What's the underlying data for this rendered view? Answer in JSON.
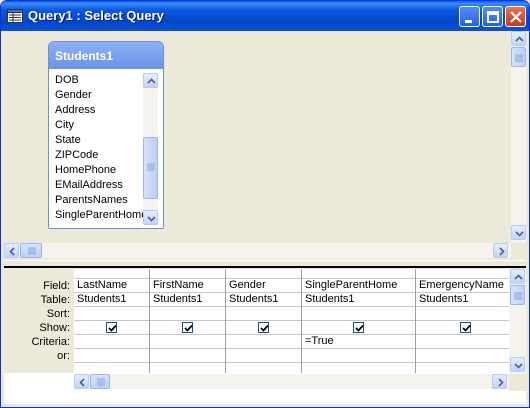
{
  "window": {
    "title": "Query1 : Select Query",
    "icon": "query-window-icon",
    "controls": [
      "minimize-icon",
      "maximize-icon",
      "close-icon"
    ],
    "titlebar_color": "#0b58e0"
  },
  "table": {
    "title": "Students1",
    "fields": [
      "DOB",
      "Gender",
      "Address",
      "City",
      "State",
      "ZIPCode",
      "HomePhone",
      "EMailAddress",
      "ParentsNames",
      "SingleParentHome"
    ]
  },
  "grid": {
    "row_labels": [
      "Field:",
      "Table:",
      "Sort:",
      "Show:",
      "Criteria:",
      "or:"
    ],
    "columns": [
      {
        "field": "LastName",
        "table": "Students1",
        "sort": "",
        "show": true,
        "criteria": "",
        "or": ""
      },
      {
        "field": "FirstName",
        "table": "Students1",
        "sort": "",
        "show": true,
        "criteria": "",
        "or": ""
      },
      {
        "field": "Gender",
        "table": "Students1",
        "sort": "",
        "show": true,
        "criteria": "",
        "or": ""
      },
      {
        "field": "SingleParentHome",
        "table": "Students1",
        "sort": "",
        "show": true,
        "criteria": "=True",
        "or": ""
      },
      {
        "field": "EmergencyName",
        "table": "Students1",
        "sort": "",
        "show": true,
        "criteria": "",
        "or": ""
      }
    ]
  }
}
